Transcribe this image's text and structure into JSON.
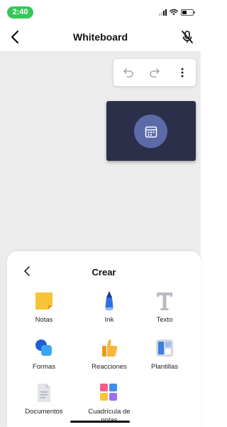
{
  "status_bar": {
    "time": "2:40",
    "time_color": "#34c759"
  },
  "header": {
    "title": "Whiteboard",
    "back_icon": "chevron-left-icon",
    "mic_icon": "mic-off-icon"
  },
  "canvas": {
    "background": "#ececec",
    "toolbar": {
      "icons": [
        "undo-icon",
        "redo-icon",
        "more-vertical-icon"
      ]
    },
    "video_tile": {
      "background": "#2b2f4a",
      "avatar_color": "#5c6aa8",
      "avatar_icon": "calendar-icon"
    }
  },
  "sheet": {
    "title": "Crear",
    "items": [
      {
        "label": "Notas",
        "icon": "sticky-note-icon"
      },
      {
        "label": "Ink",
        "icon": "pen-icon"
      },
      {
        "label": "Texto",
        "icon": "text-icon"
      },
      {
        "label": "Formas",
        "icon": "shapes-icon"
      },
      {
        "label": "Reacciones",
        "icon": "thumbs-up-icon"
      },
      {
        "label": "Plantillas",
        "icon": "template-icon"
      },
      {
        "label": "Documentos",
        "icon": "document-icon"
      },
      {
        "label": "Cuadrícula de notas",
        "icon": "notes-grid-icon"
      }
    ]
  }
}
